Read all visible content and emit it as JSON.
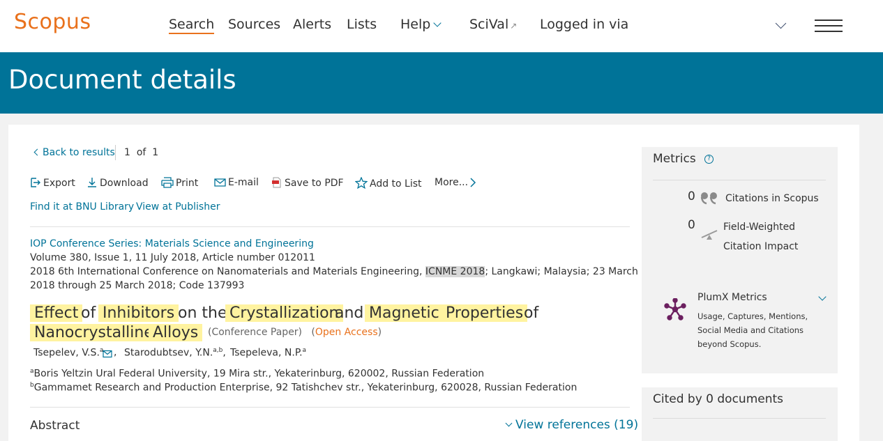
{
  "nav": {
    "logo": "Scopus",
    "links": {
      "search": "Search",
      "sources": "Sources",
      "alerts": "Alerts",
      "lists": "Lists",
      "help": "Help",
      "scival": "SciVal",
      "logged_in": "Logged in via"
    }
  },
  "banner": {
    "title": "Document details"
  },
  "results_nav": {
    "back": "Back to results",
    "page": "1",
    "of": "of",
    "total": "1"
  },
  "toolbar": {
    "export": "Export",
    "download": "Download",
    "print": "Print",
    "email": "E-mail",
    "save_pdf": "Save to PDF",
    "add_list": "Add to List",
    "more": "More..."
  },
  "find_links": {
    "library": "Find it at BNU Library",
    "publisher": "View at Publisher"
  },
  "document": {
    "source_title": "IOP Conference Series: Materials Science and Engineering",
    "volume_line": "Volume 380, Issue 1, 11 July 2018, Article number 012011",
    "conference_pre": "2018 6th International Conference on Nanomaterials and Materials Engineering,",
    "conference_acronym": "ICNME 2018",
    "conference_post": "; Langkawi; Malaysia; 23 March",
    "conference_line2": "2018 through 25 March 2018; Code 137993",
    "title_words": [
      "Effect",
      "of",
      "Inhibitors",
      "on the",
      "Crystallization",
      "and",
      "Magnetic",
      "Properties",
      "of",
      "Nanocrystalline",
      "Alloys"
    ],
    "doc_type": "(Conference Paper)",
    "open_access": "Open Access",
    "authors": [
      {
        "name": "Tsepelev, V.S.",
        "sup": "a"
      },
      {
        "name": "Starodubtsev, Y.N.",
        "sup": "a,b"
      },
      {
        "name": "Tsepeleva, N.P.",
        "sup": "a"
      }
    ],
    "affiliations": [
      {
        "sup": "a",
        "text": "Boris Yeltzin Ural Federal University, 19 Mira str., Yekaterinburg, 620002, Russian Federation"
      },
      {
        "sup": "b",
        "text": "Gammamet Research and Production Enterprise, 92 Tatishchev str., Yekaterinburg, 620028, Russian Federation"
      }
    ],
    "abstract_label": "Abstract",
    "view_refs": "View references (19)"
  },
  "metrics": {
    "title": "Metrics",
    "citations_count": "0",
    "citations_label": "Citations in Scopus",
    "fwci_count": "0",
    "fwci_label_1": "Field-Weighted",
    "fwci_label_2": "Citation Impact",
    "plumx_title": "PlumX Metrics",
    "plumx_desc": "Usage, Captures, Mentions, Social Media and Citations beyond Scopus."
  },
  "cited_by": {
    "title": "Cited by 0 documents"
  },
  "colors": {
    "brand_orange": "#e9711c",
    "banner_teal": "#007398",
    "highlight_yellow": "#fff3a0",
    "plumx_purple": "#6b1f5f"
  }
}
